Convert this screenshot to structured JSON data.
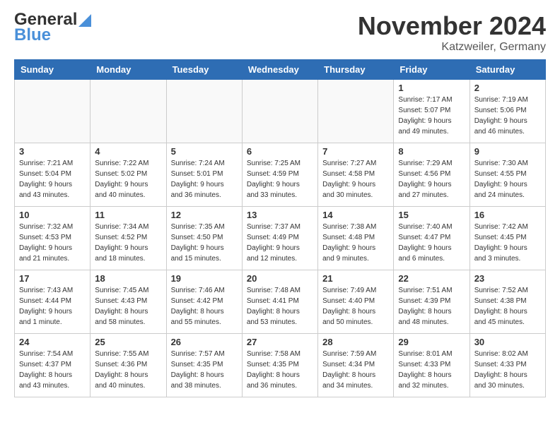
{
  "header": {
    "logo_line1": "General",
    "logo_line2": "Blue",
    "month_title": "November 2024",
    "location": "Katzweiler, Germany"
  },
  "days_of_week": [
    "Sunday",
    "Monday",
    "Tuesday",
    "Wednesday",
    "Thursday",
    "Friday",
    "Saturday"
  ],
  "weeks": [
    [
      {
        "day": "",
        "info": "",
        "empty": true
      },
      {
        "day": "",
        "info": "",
        "empty": true
      },
      {
        "day": "",
        "info": "",
        "empty": true
      },
      {
        "day": "",
        "info": "",
        "empty": true
      },
      {
        "day": "",
        "info": "",
        "empty": true
      },
      {
        "day": "1",
        "info": "Sunrise: 7:17 AM\nSunset: 5:07 PM\nDaylight: 9 hours\nand 49 minutes."
      },
      {
        "day": "2",
        "info": "Sunrise: 7:19 AM\nSunset: 5:06 PM\nDaylight: 9 hours\nand 46 minutes."
      }
    ],
    [
      {
        "day": "3",
        "info": "Sunrise: 7:21 AM\nSunset: 5:04 PM\nDaylight: 9 hours\nand 43 minutes."
      },
      {
        "day": "4",
        "info": "Sunrise: 7:22 AM\nSunset: 5:02 PM\nDaylight: 9 hours\nand 40 minutes."
      },
      {
        "day": "5",
        "info": "Sunrise: 7:24 AM\nSunset: 5:01 PM\nDaylight: 9 hours\nand 36 minutes."
      },
      {
        "day": "6",
        "info": "Sunrise: 7:25 AM\nSunset: 4:59 PM\nDaylight: 9 hours\nand 33 minutes."
      },
      {
        "day": "7",
        "info": "Sunrise: 7:27 AM\nSunset: 4:58 PM\nDaylight: 9 hours\nand 30 minutes."
      },
      {
        "day": "8",
        "info": "Sunrise: 7:29 AM\nSunset: 4:56 PM\nDaylight: 9 hours\nand 27 minutes."
      },
      {
        "day": "9",
        "info": "Sunrise: 7:30 AM\nSunset: 4:55 PM\nDaylight: 9 hours\nand 24 minutes."
      }
    ],
    [
      {
        "day": "10",
        "info": "Sunrise: 7:32 AM\nSunset: 4:53 PM\nDaylight: 9 hours\nand 21 minutes."
      },
      {
        "day": "11",
        "info": "Sunrise: 7:34 AM\nSunset: 4:52 PM\nDaylight: 9 hours\nand 18 minutes."
      },
      {
        "day": "12",
        "info": "Sunrise: 7:35 AM\nSunset: 4:50 PM\nDaylight: 9 hours\nand 15 minutes."
      },
      {
        "day": "13",
        "info": "Sunrise: 7:37 AM\nSunset: 4:49 PM\nDaylight: 9 hours\nand 12 minutes."
      },
      {
        "day": "14",
        "info": "Sunrise: 7:38 AM\nSunset: 4:48 PM\nDaylight: 9 hours\nand 9 minutes."
      },
      {
        "day": "15",
        "info": "Sunrise: 7:40 AM\nSunset: 4:47 PM\nDaylight: 9 hours\nand 6 minutes."
      },
      {
        "day": "16",
        "info": "Sunrise: 7:42 AM\nSunset: 4:45 PM\nDaylight: 9 hours\nand 3 minutes."
      }
    ],
    [
      {
        "day": "17",
        "info": "Sunrise: 7:43 AM\nSunset: 4:44 PM\nDaylight: 9 hours\nand 1 minute."
      },
      {
        "day": "18",
        "info": "Sunrise: 7:45 AM\nSunset: 4:43 PM\nDaylight: 8 hours\nand 58 minutes."
      },
      {
        "day": "19",
        "info": "Sunrise: 7:46 AM\nSunset: 4:42 PM\nDaylight: 8 hours\nand 55 minutes."
      },
      {
        "day": "20",
        "info": "Sunrise: 7:48 AM\nSunset: 4:41 PM\nDaylight: 8 hours\nand 53 minutes."
      },
      {
        "day": "21",
        "info": "Sunrise: 7:49 AM\nSunset: 4:40 PM\nDaylight: 8 hours\nand 50 minutes."
      },
      {
        "day": "22",
        "info": "Sunrise: 7:51 AM\nSunset: 4:39 PM\nDaylight: 8 hours\nand 48 minutes."
      },
      {
        "day": "23",
        "info": "Sunrise: 7:52 AM\nSunset: 4:38 PM\nDaylight: 8 hours\nand 45 minutes."
      }
    ],
    [
      {
        "day": "24",
        "info": "Sunrise: 7:54 AM\nSunset: 4:37 PM\nDaylight: 8 hours\nand 43 minutes."
      },
      {
        "day": "25",
        "info": "Sunrise: 7:55 AM\nSunset: 4:36 PM\nDaylight: 8 hours\nand 40 minutes."
      },
      {
        "day": "26",
        "info": "Sunrise: 7:57 AM\nSunset: 4:35 PM\nDaylight: 8 hours\nand 38 minutes."
      },
      {
        "day": "27",
        "info": "Sunrise: 7:58 AM\nSunset: 4:35 PM\nDaylight: 8 hours\nand 36 minutes."
      },
      {
        "day": "28",
        "info": "Sunrise: 7:59 AM\nSunset: 4:34 PM\nDaylight: 8 hours\nand 34 minutes."
      },
      {
        "day": "29",
        "info": "Sunrise: 8:01 AM\nSunset: 4:33 PM\nDaylight: 8 hours\nand 32 minutes."
      },
      {
        "day": "30",
        "info": "Sunrise: 8:02 AM\nSunset: 4:33 PM\nDaylight: 8 hours\nand 30 minutes."
      }
    ]
  ]
}
